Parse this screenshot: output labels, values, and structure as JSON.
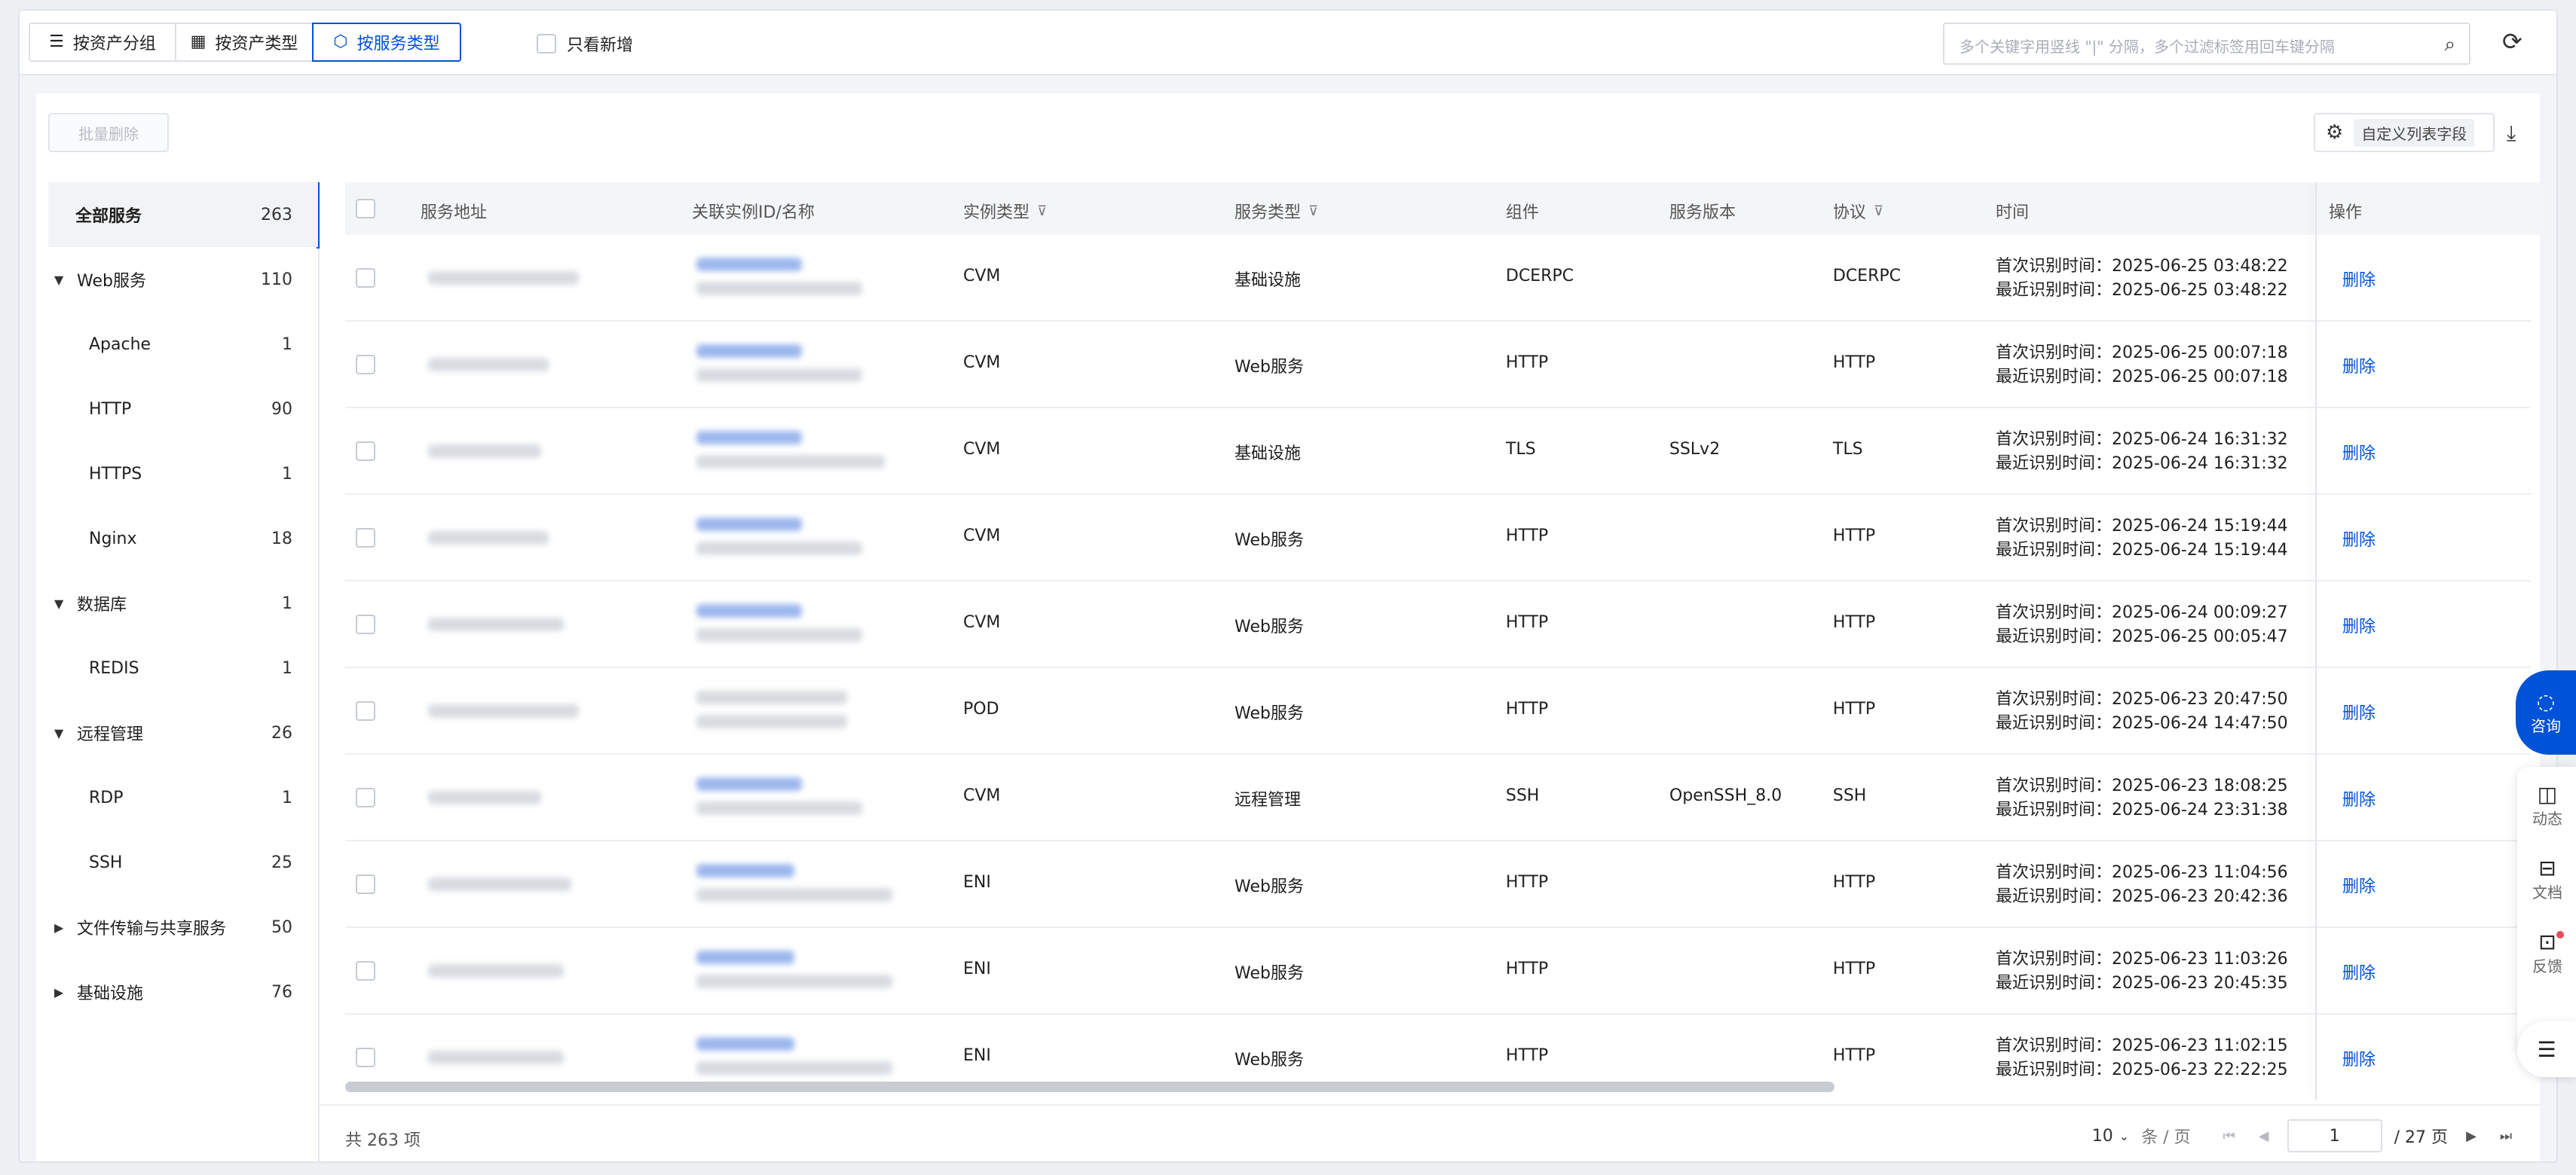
{
  "tabs": [
    {
      "label": "按资产分组",
      "icon": "list-icon"
    },
    {
      "label": "按资产类型",
      "icon": "table-icon"
    },
    {
      "label": "按服务类型",
      "icon": "service-icon",
      "active": true
    }
  ],
  "only_new_label": "只看新增",
  "search": {
    "placeholder": "多个关键字用竖线 \"|\" 分隔，多个过滤标签用回车键分隔"
  },
  "toolbar": {
    "batch_delete": "批量删除",
    "custom_columns": "自定义列表字段"
  },
  "sidebar": {
    "items": [
      {
        "label": "全部服务",
        "count": "263",
        "level": 0,
        "selected": true
      },
      {
        "label": "Web服务",
        "count": "110",
        "level": 1,
        "expanded": true
      },
      {
        "label": "Apache",
        "count": "1",
        "level": 2
      },
      {
        "label": "HTTP",
        "count": "90",
        "level": 2
      },
      {
        "label": "HTTPS",
        "count": "1",
        "level": 2
      },
      {
        "label": "Nginx",
        "count": "18",
        "level": 2
      },
      {
        "label": "数据库",
        "count": "1",
        "level": 1,
        "expanded": true
      },
      {
        "label": "REDIS",
        "count": "1",
        "level": 2
      },
      {
        "label": "远程管理",
        "count": "26",
        "level": 1,
        "expanded": true
      },
      {
        "label": "RDP",
        "count": "1",
        "level": 2
      },
      {
        "label": "SSH",
        "count": "25",
        "level": 2
      },
      {
        "label": "文件传输与共享服务",
        "count": "50",
        "level": 1,
        "expanded": false
      },
      {
        "label": "基础设施",
        "count": "76",
        "level": 1,
        "expanded": false
      }
    ]
  },
  "table": {
    "headers": {
      "address": "服务地址",
      "instance": "关联实例ID/名称",
      "instance_type": "实例类型",
      "service_type": "服务类型",
      "component": "组件",
      "version": "服务版本",
      "protocol": "协议",
      "time": "时间",
      "ops": "操作"
    },
    "rows": [
      {
        "instance_type": "CVM",
        "service_type": "基础设施",
        "component": "DCERPC",
        "version": "",
        "protocol": "DCERPC",
        "first": "首次识别时间：2025-06-25 03:48:22",
        "last": "最近识别时间：2025-06-25 03:48:22",
        "action": "删除"
      },
      {
        "instance_type": "CVM",
        "service_type": "Web服务",
        "component": "HTTP",
        "version": "",
        "protocol": "HTTP",
        "first": "首次识别时间：2025-06-25 00:07:18",
        "last": "最近识别时间：2025-06-25 00:07:18",
        "action": "删除"
      },
      {
        "instance_type": "CVM",
        "service_type": "基础设施",
        "component": "TLS",
        "version": "SSLv2",
        "protocol": "TLS",
        "first": "首次识别时间：2025-06-24 16:31:32",
        "last": "最近识别时间：2025-06-24 16:31:32",
        "action": "删除"
      },
      {
        "instance_type": "CVM",
        "service_type": "Web服务",
        "component": "HTTP",
        "version": "",
        "protocol": "HTTP",
        "first": "首次识别时间：2025-06-24 15:19:44",
        "last": "最近识别时间：2025-06-24 15:19:44",
        "action": "删除"
      },
      {
        "instance_type": "CVM",
        "service_type": "Web服务",
        "component": "HTTP",
        "version": "",
        "protocol": "HTTP",
        "first": "首次识别时间：2025-06-24 00:09:27",
        "last": "最近识别时间：2025-06-25 00:05:47",
        "action": "删除"
      },
      {
        "instance_type": "POD",
        "service_type": "Web服务",
        "component": "HTTP",
        "version": "",
        "protocol": "HTTP",
        "first": "首次识别时间：2025-06-23 20:47:50",
        "last": "最近识别时间：2025-06-24 14:47:50",
        "action": "删除"
      },
      {
        "instance_type": "CVM",
        "service_type": "远程管理",
        "component": "SSH",
        "version": "OpenSSH_8.0",
        "protocol": "SSH",
        "first": "首次识别时间：2025-06-23 18:08:25",
        "last": "最近识别时间：2025-06-24 23:31:38",
        "action": "删除"
      },
      {
        "instance_type": "ENI",
        "service_type": "Web服务",
        "component": "HTTP",
        "version": "",
        "protocol": "HTTP",
        "first": "首次识别时间：2025-06-23 11:04:56",
        "last": "最近识别时间：2025-06-23 20:42:36",
        "action": "删除"
      },
      {
        "instance_type": "ENI",
        "service_type": "Web服务",
        "component": "HTTP",
        "version": "",
        "protocol": "HTTP",
        "first": "首次识别时间：2025-06-23 11:03:26",
        "last": "最近识别时间：2025-06-23 20:45:35",
        "action": "删除"
      },
      {
        "instance_type": "ENI",
        "service_type": "Web服务",
        "component": "HTTP",
        "version": "",
        "protocol": "HTTP",
        "first": "首次识别时间：2025-06-23 11:02:15",
        "last": "最近识别时间：2025-06-23 22:22:25",
        "action": "删除"
      }
    ]
  },
  "footer": {
    "total": "共 263 项",
    "page_size": "10",
    "page_size_unit": "条 / 页",
    "current_page": "1",
    "total_pages": "/ 27 页"
  },
  "floating": {
    "consult": "咨询",
    "items": [
      "动态",
      "文档",
      "反馈"
    ]
  },
  "colors": {
    "accent": "#0052d9",
    "danger_dot": "#e34d59"
  }
}
